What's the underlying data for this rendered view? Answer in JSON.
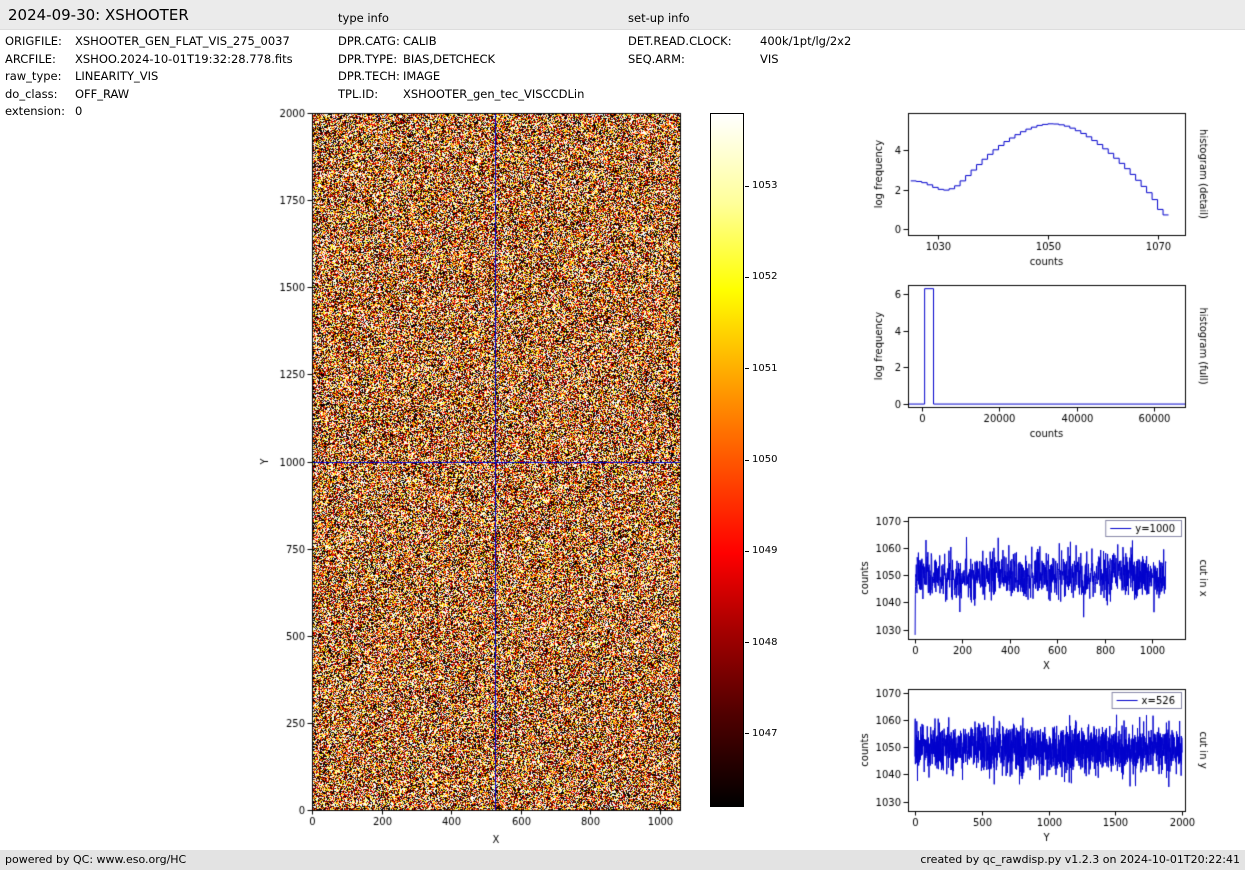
{
  "page": {
    "title": "2024-09-30: XSHOOTER",
    "type_info_heading": "type info",
    "setup_info_heading": "set-up info"
  },
  "file_info": [
    {
      "label": "ORIGFILE:",
      "value": "XSHOOTER_GEN_FLAT_VIS_275_0037"
    },
    {
      "label": "ARCFILE:",
      "value": "XSHOO.2024-10-01T19:32:28.778.fits"
    },
    {
      "label": "raw_type:",
      "value": "LINEARITY_VIS"
    },
    {
      "label": "do_class:",
      "value": "OFF_RAW"
    },
    {
      "label": "extension:",
      "value": "0"
    }
  ],
  "type_info": [
    {
      "label": "DPR.CATG:",
      "value": "CALIB"
    },
    {
      "label": "DPR.TYPE:",
      "value": "BIAS,DETCHECK"
    },
    {
      "label": "DPR.TECH:",
      "value": "IMAGE"
    },
    {
      "label": "TPL.ID:",
      "value": "XSHOOTER_gen_tec_VISCCDLin"
    }
  ],
  "setup_info": [
    {
      "label": "DET.READ.CLOCK:",
      "value": "400k/1pt/lg/2x2"
    },
    {
      "label": "SEQ.ARM:",
      "value": "VIS"
    }
  ],
  "footer": {
    "left": "powered by QC: www.eso.org/HC",
    "right": "created by qc_rawdisp.py v1.2.3 on 2024-10-01T20:22:41"
  },
  "chart_data": [
    {
      "id": "detector_image",
      "type": "heatmap",
      "description": "raw detector frame, uniform random noise around 1050 counts, hot colormap",
      "xlabel": "X",
      "ylabel": "Y",
      "xlim": [
        0,
        1058
      ],
      "ylim": [
        0,
        2000
      ],
      "xticks": [
        0,
        200,
        400,
        600,
        800,
        1000
      ],
      "yticks": [
        0,
        250,
        500,
        750,
        1000,
        1250,
        1500,
        1750,
        2000
      ],
      "colormap": "hot",
      "vmin": 1046.2,
      "vmax": 1053.8,
      "noise": {
        "mean": 1050,
        "std": 5,
        "seed": 42
      },
      "crosshair": {
        "x": 526,
        "y": 1000,
        "color": "#0000cd"
      },
      "colorbar": {
        "ticks": [
          1047,
          1048,
          1049,
          1050,
          1051,
          1052,
          1053
        ]
      }
    },
    {
      "id": "hist_detail",
      "type": "line",
      "right_label": "histogram (detail)",
      "xlabel": "counts",
      "ylabel": "log frequency",
      "xlim": [
        1024.5,
        1075
      ],
      "ylim": [
        -0.3,
        5.9
      ],
      "xticks": [
        1030,
        1050,
        1070
      ],
      "yticks": [
        0,
        2,
        4
      ],
      "step": true,
      "color": "#0000cc",
      "grid": false,
      "x": [
        1025,
        1026,
        1027,
        1028,
        1029,
        1030,
        1031,
        1032,
        1033,
        1034,
        1035,
        1036,
        1037,
        1038,
        1039,
        1040,
        1041,
        1042,
        1043,
        1044,
        1045,
        1046,
        1047,
        1048,
        1049,
        1050,
        1051,
        1052,
        1053,
        1054,
        1055,
        1056,
        1057,
        1058,
        1059,
        1060,
        1061,
        1062,
        1063,
        1064,
        1065,
        1066,
        1067,
        1068,
        1069,
        1070,
        1071
      ],
      "y": [
        2.45,
        2.42,
        2.36,
        2.25,
        2.12,
        2.02,
        1.98,
        2.05,
        2.2,
        2.45,
        2.72,
        3.0,
        3.28,
        3.55,
        3.8,
        4.03,
        4.25,
        4.45,
        4.63,
        4.8,
        4.95,
        5.08,
        5.18,
        5.27,
        5.32,
        5.35,
        5.34,
        5.3,
        5.23,
        5.13,
        5.0,
        4.86,
        4.69,
        4.5,
        4.3,
        4.08,
        3.85,
        3.6,
        3.34,
        3.07,
        2.78,
        2.48,
        2.17,
        1.85,
        1.5,
        1.0,
        0.72
      ]
    },
    {
      "id": "hist_full",
      "type": "line",
      "right_label": "histogram (full)",
      "xlabel": "counts",
      "ylabel": "log frequency",
      "xlim": [
        -3600,
        68000
      ],
      "ylim": [
        -0.16,
        6.5
      ],
      "xticks": [
        0,
        20000,
        40000,
        60000
      ],
      "yticks": [
        0,
        2,
        4,
        6
      ],
      "step": false,
      "color": "#0000cc",
      "grid": false,
      "x": [
        -3600,
        700,
        700,
        3000,
        3000,
        68000
      ],
      "y": [
        0,
        0,
        6.3,
        6.3,
        0,
        0
      ]
    },
    {
      "id": "cut_x",
      "type": "line",
      "right_label": "cut in x",
      "legend": "y=1000",
      "xlabel": "X",
      "ylabel": "counts",
      "xlim": [
        -30,
        1140
      ],
      "ylim": [
        1026.5,
        1071.5
      ],
      "xticks": [
        0,
        200,
        400,
        600,
        800,
        1000
      ],
      "yticks": [
        1030,
        1040,
        1050,
        1060,
        1070
      ],
      "color": "#0000cc",
      "grid": false,
      "noise": {
        "n": 1060,
        "mean": 1050,
        "std": 4.3,
        "seed": 7,
        "first_dip": 1028
      }
    },
    {
      "id": "cut_y",
      "type": "line",
      "right_label": "cut in y",
      "legend": "x=526",
      "xlabel": "Y",
      "ylabel": "counts",
      "xlim": [
        -52,
        2020
      ],
      "ylim": [
        1026.5,
        1071.5
      ],
      "xticks": [
        0,
        500,
        1000,
        1500,
        2000
      ],
      "yticks": [
        1030,
        1040,
        1050,
        1060,
        1070
      ],
      "color": "#0000cc",
      "grid": false,
      "noise": {
        "n": 2000,
        "mean": 1049.5,
        "std": 4.3,
        "seed": 13
      }
    }
  ]
}
